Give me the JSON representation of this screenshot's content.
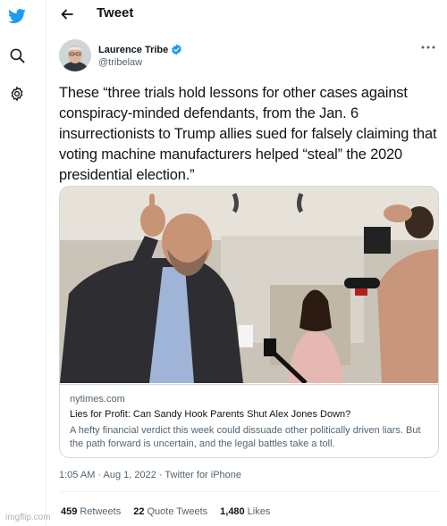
{
  "header": {
    "title": "Tweet"
  },
  "author": {
    "name": "Laurence Tribe",
    "handle": "@tribelaw"
  },
  "tweet": {
    "text": "These “three trials hold lessons for other cases against conspiracy-minded defendants, from the Jan. 6 insurrectionists to Trump allies sued for falsely claiming that voting machine manufacturers helped “steal” the 2020 presidential election.”"
  },
  "card": {
    "domain": "nytimes.com",
    "title": "Lies for Profit: Can Sandy Hook Parents Shut Alex Jones Down?",
    "description": "A hefty financial verdict this week could dissuade other politically driven liars. But the path forward is uncertain, and the legal battles take a toll."
  },
  "meta": {
    "timestamp": "1:05 AM · Aug 1, 2022 · Twitter for iPhone"
  },
  "stats": {
    "retweets_count": "459",
    "retweets_label": "Retweets",
    "quotes_count": "22",
    "quotes_label": "Quote Tweets",
    "likes_count": "1,480",
    "likes_label": "Likes"
  },
  "watermark": "imgflip.com",
  "colors": {
    "twitter_blue": "#1d9bf0",
    "secondary_text": "#536471",
    "border": "#cfd9de"
  }
}
